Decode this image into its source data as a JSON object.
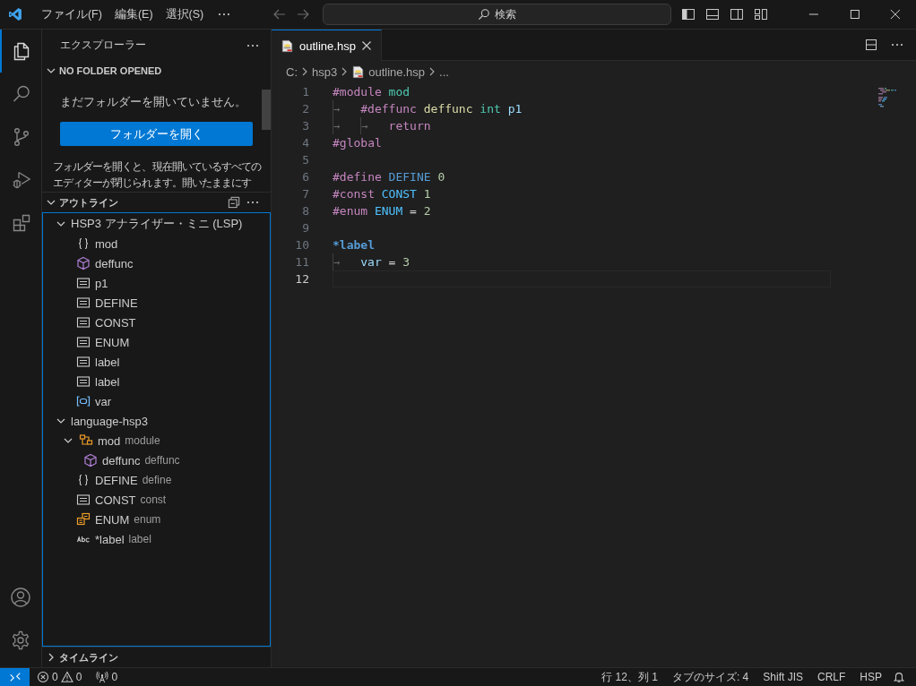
{
  "title_bar": {
    "menus": [
      "ファイル(F)",
      "編集(E)",
      "選択(S)"
    ],
    "search": {
      "placeholder": "検索"
    }
  },
  "activity_bar": {
    "items": [
      {
        "kind": "files",
        "selected": true
      },
      {
        "kind": "search",
        "selected": false
      },
      {
        "kind": "source-control",
        "selected": false
      },
      {
        "kind": "run",
        "selected": false
      },
      {
        "kind": "extensions",
        "selected": false
      }
    ]
  },
  "sidebar": {
    "title": "エクスプローラー",
    "no_folder": {
      "header": "NO FOLDER OPENED",
      "expanded": true,
      "message": "まだフォルダーを開いていません。",
      "button": "フォルダーを開く",
      "description": "フォルダーを開くと、現在開いているすべてのエディターが閉じられます。開いたままにす"
    },
    "outline": {
      "header": "アウトライン",
      "expanded": true,
      "groups": [
        {
          "label": "HSP3 アナライザー・ミニ (LSP)",
          "expanded": true,
          "children": [
            {
              "kind": "namespace",
              "label": "mod"
            },
            {
              "kind": "function",
              "label": "deffunc"
            },
            {
              "kind": "field",
              "label": "p1"
            },
            {
              "kind": "field",
              "label": "DEFINE"
            },
            {
              "kind": "field",
              "label": "CONST"
            },
            {
              "kind": "field",
              "label": "ENUM"
            },
            {
              "kind": "field",
              "label": "label"
            },
            {
              "kind": "field",
              "label": "label"
            },
            {
              "kind": "variable",
              "label": "var"
            }
          ]
        },
        {
          "label": "language-hsp3",
          "expanded": true,
          "children": [
            {
              "kind": "module",
              "label": "mod",
              "detail": "module",
              "expanded": true,
              "children": [
                {
                  "kind": "function",
                  "label": "deffunc",
                  "detail": "deffunc"
                }
              ]
            },
            {
              "kind": "namespace",
              "label": "DEFINE",
              "detail": "define"
            },
            {
              "kind": "field",
              "label": "CONST",
              "detail": "const"
            },
            {
              "kind": "enum",
              "label": "ENUM",
              "detail": "enum"
            },
            {
              "kind": "string",
              "label": "*label",
              "detail": "label"
            }
          ]
        }
      ]
    },
    "timeline": {
      "header": "タイムライン",
      "expanded": false
    }
  },
  "editor": {
    "tabs": [
      {
        "label": "outline.hsp",
        "selected": true
      }
    ],
    "breadcrumbs": [
      "C:",
      "hsp3",
      "outline.hsp",
      "..."
    ],
    "lines": [
      {
        "number": "1",
        "current": false,
        "tokens": [
          {
            "kind": "directive",
            "text": "#module"
          },
          {
            "kind": "type",
            "text": "mod"
          }
        ]
      },
      {
        "number": "2",
        "current": false,
        "tokens": [
          {
            "kind": "tab",
            "text": "→"
          },
          {
            "kind": "directive",
            "text": "#deffunc"
          },
          {
            "kind": "function",
            "text": "deffunc"
          },
          {
            "kind": "type",
            "text": "int"
          },
          {
            "kind": "param",
            "text": "p1"
          }
        ]
      },
      {
        "number": "3",
        "current": false,
        "tokens": [
          {
            "kind": "tab",
            "text": "→"
          },
          {
            "kind": "tab",
            "text": "→"
          },
          {
            "kind": "directive",
            "text": "return"
          }
        ]
      },
      {
        "number": "4",
        "current": false,
        "tokens": [
          {
            "kind": "directive",
            "text": "#global"
          }
        ]
      },
      {
        "number": "5",
        "current": false
      },
      {
        "number": "6",
        "current": false,
        "tokens": [
          {
            "kind": "directive",
            "text": "#define"
          },
          {
            "kind": "macro",
            "text": "DEFINE"
          },
          {
            "kind": "number",
            "text": "0"
          }
        ]
      },
      {
        "number": "7",
        "current": false,
        "tokens": [
          {
            "kind": "directive",
            "text": "#const"
          },
          {
            "kind": "constant",
            "text": "CONST"
          },
          {
            "kind": "number",
            "text": "1"
          }
        ]
      },
      {
        "number": "8",
        "current": false,
        "tokens": [
          {
            "kind": "directive",
            "text": "#enum"
          },
          {
            "kind": "constant",
            "text": "ENUM"
          },
          {
            "kind": "operator",
            "text": "="
          },
          {
            "kind": "number",
            "text": "2"
          }
        ]
      },
      {
        "number": "9",
        "current": false
      },
      {
        "number": "10",
        "current": false,
        "tokens": [
          {
            "kind": "label",
            "text": "*label"
          }
        ]
      },
      {
        "number": "11",
        "current": false,
        "tokens": [
          {
            "kind": "tab",
            "text": "→"
          },
          {
            "kind": "param",
            "text": "var"
          },
          {
            "kind": "operator",
            "text": "="
          },
          {
            "kind": "number",
            "text": "3"
          }
        ]
      },
      {
        "number": "12",
        "current": true
      }
    ]
  },
  "status_bar": {
    "problems": {
      "errors": "0",
      "warnings": "0"
    },
    "ports": "0",
    "items": [
      "行 12、列 1",
      "タブのサイズ: 4",
      "Shift JIS",
      "CRLF",
      "HSP"
    ]
  }
}
